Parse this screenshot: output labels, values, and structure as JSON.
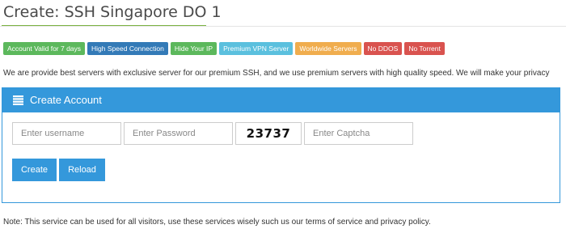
{
  "page": {
    "title": "Create: SSH Singapore DO 1"
  },
  "badges": [
    {
      "label": "Account Valid for 7 days",
      "color": "#5cb85c"
    },
    {
      "label": "High Speed Connection",
      "color": "#337ab7"
    },
    {
      "label": "Hide Your IP",
      "color": "#5cb85c"
    },
    {
      "label": "Premium VPN Server",
      "color": "#5bc0de"
    },
    {
      "label": "Worldwide Servers",
      "color": "#f0ad4e"
    },
    {
      "label": "No DDOS",
      "color": "#d9534f"
    },
    {
      "label": "No Torrent",
      "color": "#d9534f"
    }
  ],
  "intro_text": "We are provide best servers with exclusive server for our premium SSH, and we use premium servers with high quality speed. We will make your privacy",
  "panel": {
    "title": "Create Account",
    "icon": "list-icon",
    "accent_color": "#3498db",
    "form": {
      "username_placeholder": "Enter username",
      "password_placeholder": "Enter Password",
      "captcha_code": "23737",
      "captcha_placeholder": "Enter Captcha",
      "create_label": "Create",
      "reload_label": "Reload"
    }
  },
  "note_text": "Note: This service can be used for all visitors, use these services wisely such us our terms of service and privacy policy."
}
